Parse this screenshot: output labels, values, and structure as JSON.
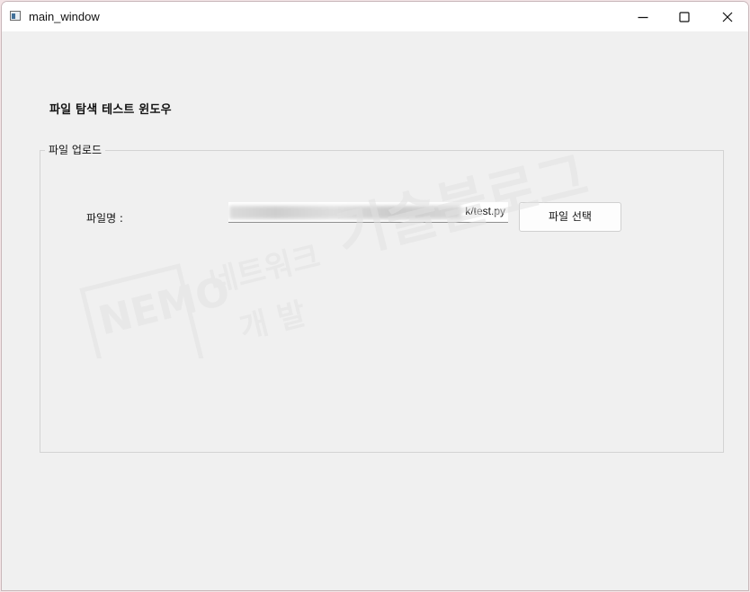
{
  "window": {
    "title": "main_window"
  },
  "heading": "파일 탐색 테스트 윈도우",
  "upload_group": {
    "title": "파일 업로드",
    "file_label": "파일명 :",
    "file_value": "k/test.py",
    "select_button_label": "파일 선택"
  },
  "icons": {
    "app": "app-window-icon",
    "minimize": "minimize-icon",
    "maximize": "maximize-icon",
    "close": "close-icon"
  },
  "watermark": {
    "logo_letters": "NEMO",
    "text_blog": "기술블로그",
    "text_network": "네트워크",
    "text_dev": "개 발"
  },
  "colors": {
    "window_background": "#f0f0f0",
    "titlebar_background": "#ffffff",
    "button_background": "#fdfdfd"
  }
}
